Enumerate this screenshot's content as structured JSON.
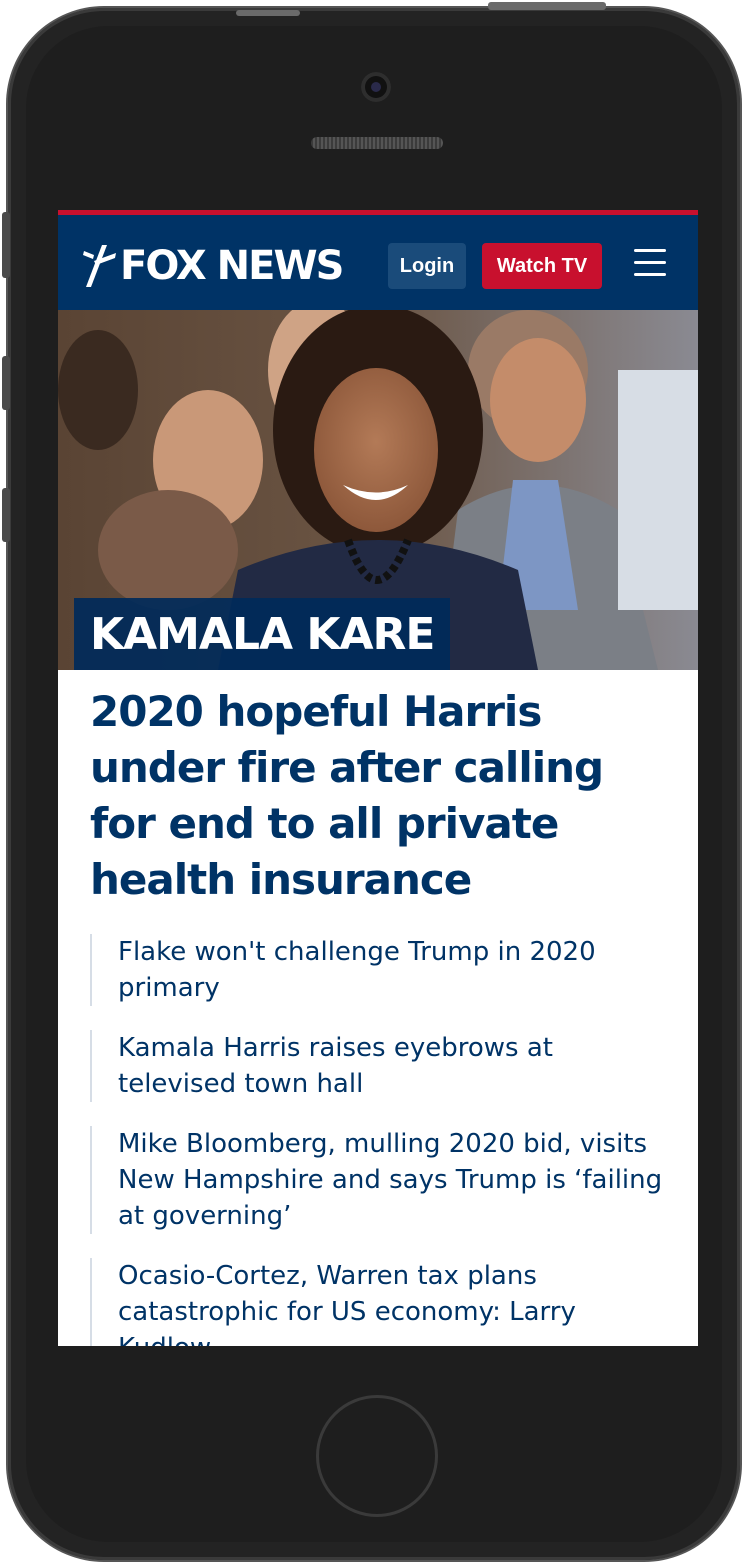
{
  "header": {
    "logo_text": "FOX NEWS",
    "login_label": "Login",
    "watch_label": "Watch TV"
  },
  "hero": {
    "kicker": "KAMALA KARE"
  },
  "article": {
    "headline": "2020 hopeful Harris under fire after calling for end to all private health insurance"
  },
  "related": [
    {
      "title": "Flake won't challenge Trump in 2020 primary"
    },
    {
      "title": "Kamala Harris raises eyebrows at televised town hall"
    },
    {
      "title": "Mike Bloomberg, mulling 2020 bid, visits New Hampshire and says Trump is ‘failing at governing’"
    },
    {
      "title": "Ocasio-Cortez, Warren tax plans catastrophic for US economy: Larry Kudlow"
    }
  ],
  "colors": {
    "brand_navy": "#003366",
    "brand_red": "#c8102e"
  }
}
